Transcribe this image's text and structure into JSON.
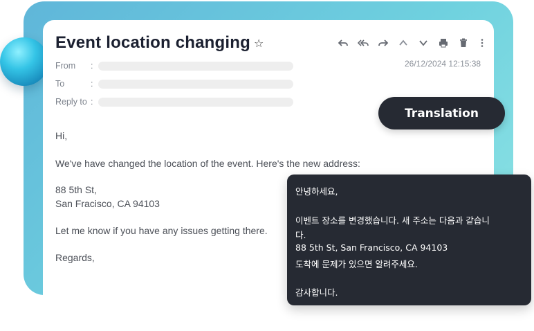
{
  "email": {
    "subject": "Event location changing",
    "star_icon": "☆",
    "timestamp": "26/12/2024 12:15:38",
    "headers": {
      "from_label": "From",
      "to_label": "To",
      "reply_to_label": "Reply to",
      "colon": ":"
    },
    "body": {
      "greeting": "Hi,",
      "line1": "We've have changed the location of the event. Here's the new address:",
      "address_line1": "88 5th St,",
      "address_line2": "San Fracisco, CA 94103",
      "line2": "Let me know if you have any issues getting there.",
      "closing": "Regards,"
    }
  },
  "toolbar": {
    "icons": [
      "reply-icon",
      "reply-all-icon",
      "forward-icon",
      "chevron-up-icon",
      "chevron-down-icon",
      "print-icon",
      "trash-icon",
      "more-icon"
    ]
  },
  "translation": {
    "button_label": "Translation",
    "lines": [
      "안녕하세요,",
      "이벤트 장소를 변경했습니다. 새 주소는 다음과 같습니",
      "다.",
      " 88 5th St, San Francisco, CA 94103",
      " 도착에 문제가 있으면 알려주세요.",
      "감사합니다."
    ]
  },
  "colors": {
    "accent_gradient_start": "#5fb6d9",
    "accent_gradient_end": "#8fe4e4",
    "dark_panel": "#262a33"
  }
}
